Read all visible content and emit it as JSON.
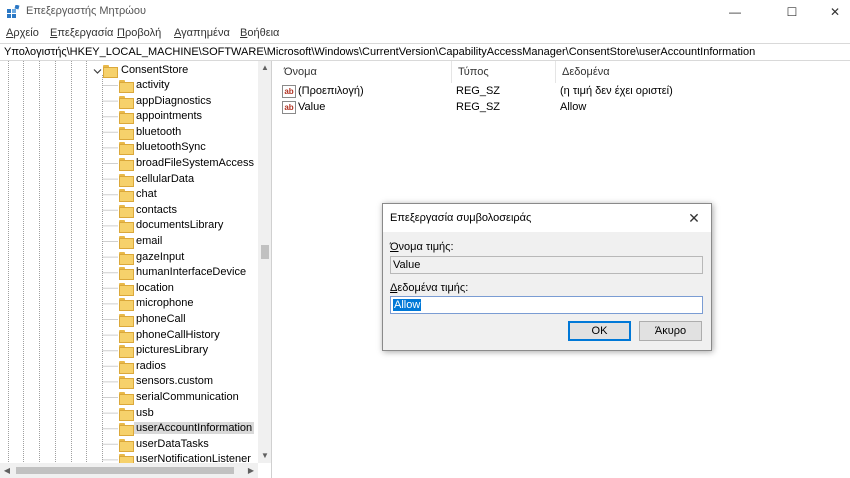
{
  "window": {
    "title": "Επεξεργαστής Μητρώου",
    "minimize_glyph": "—",
    "maximize_glyph": "☐",
    "close_glyph": "✕"
  },
  "menu": [
    {
      "first": "Α",
      "rest": "ρχείο"
    },
    {
      "first": "Ε",
      "rest": "πεξεργασία"
    },
    {
      "first": "Π",
      "rest": "ροβολή"
    },
    {
      "first": "Α",
      "rest": "γαπημένα"
    },
    {
      "first": "Β",
      "rest": "οήθεια"
    }
  ],
  "address": "Υπολογιστής\\HKEY_LOCAL_MACHINE\\SOFTWARE\\Microsoft\\Windows\\CurrentVersion\\CapabilityAccessManager\\ConsentStore\\userAccountInformation",
  "tree": {
    "parent": "ConsentStore",
    "children": [
      "activity",
      "appDiagnostics",
      "appointments",
      "bluetooth",
      "bluetoothSync",
      "broadFileSystemAccess",
      "cellularData",
      "chat",
      "contacts",
      "documentsLibrary",
      "email",
      "gazeInput",
      "humanInterfaceDevice",
      "location",
      "microphone",
      "phoneCall",
      "phoneCallHistory",
      "picturesLibrary",
      "radios",
      "sensors.custom",
      "serialCommunication",
      "usb",
      "userAccountInformation",
      "userDataTasks",
      "userNotificationListener"
    ],
    "selected": "userAccountInformation",
    "scroll_up_glyph": "▲",
    "scroll_down_glyph": "▼",
    "scroll_left_glyph": "◀",
    "scroll_right_glyph": "▶"
  },
  "list": {
    "columns": [
      "Όνομα",
      "Τύπος",
      "Δεδομένα"
    ],
    "rows": [
      {
        "icon": "string-value-icon",
        "icon_text": "ab",
        "name": "(Προεπιλογή)",
        "type": "REG_SZ",
        "data": "(η τιμή δεν έχει οριστεί)"
      },
      {
        "icon": "string-value-icon",
        "icon_text": "ab",
        "name": "Value",
        "type": "REG_SZ",
        "data": "Allow"
      }
    ]
  },
  "dialog": {
    "title": "Επεξεργασία συμβολοσειράς",
    "close_glyph": "✕",
    "value_name_label_first": "Ό",
    "value_name_label_rest": "νομα τιμής:",
    "value_name": "Value",
    "value_data_label_first": "Δ",
    "value_data_label_rest": "εδομένα τιμής:",
    "value_data": "Allow",
    "ok_label": "OK",
    "cancel_label": "Άκυρο"
  },
  "colors": {
    "selection": "#0078d7",
    "folder": "#f6d16b"
  }
}
